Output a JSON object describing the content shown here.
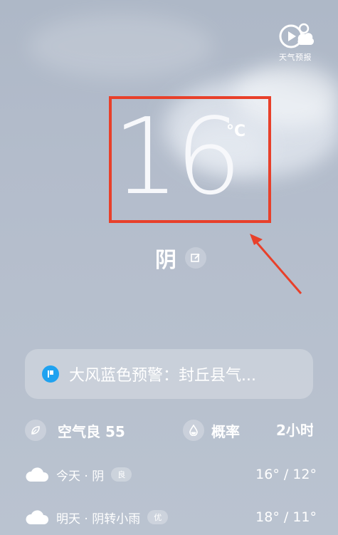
{
  "app": {
    "logo_label": "天气预报"
  },
  "current": {
    "temperature": "16",
    "unit": "°C",
    "condition": "阴"
  },
  "alert": {
    "text": "大风蓝色预警：封丘县气..."
  },
  "stats": {
    "air_quality_label": "空气良 55",
    "probability_label": "概率",
    "probability_value": "2小时"
  },
  "forecast": [
    {
      "label": "今天 · 阴",
      "aqi": "良",
      "temps": "16° / 12°"
    },
    {
      "label": "明天 · 阴转小雨",
      "aqi": "优",
      "temps": "18° / 11°"
    }
  ],
  "colors": {
    "highlight_box": "#e8402a",
    "alert_icon": "#1fa2f0"
  }
}
